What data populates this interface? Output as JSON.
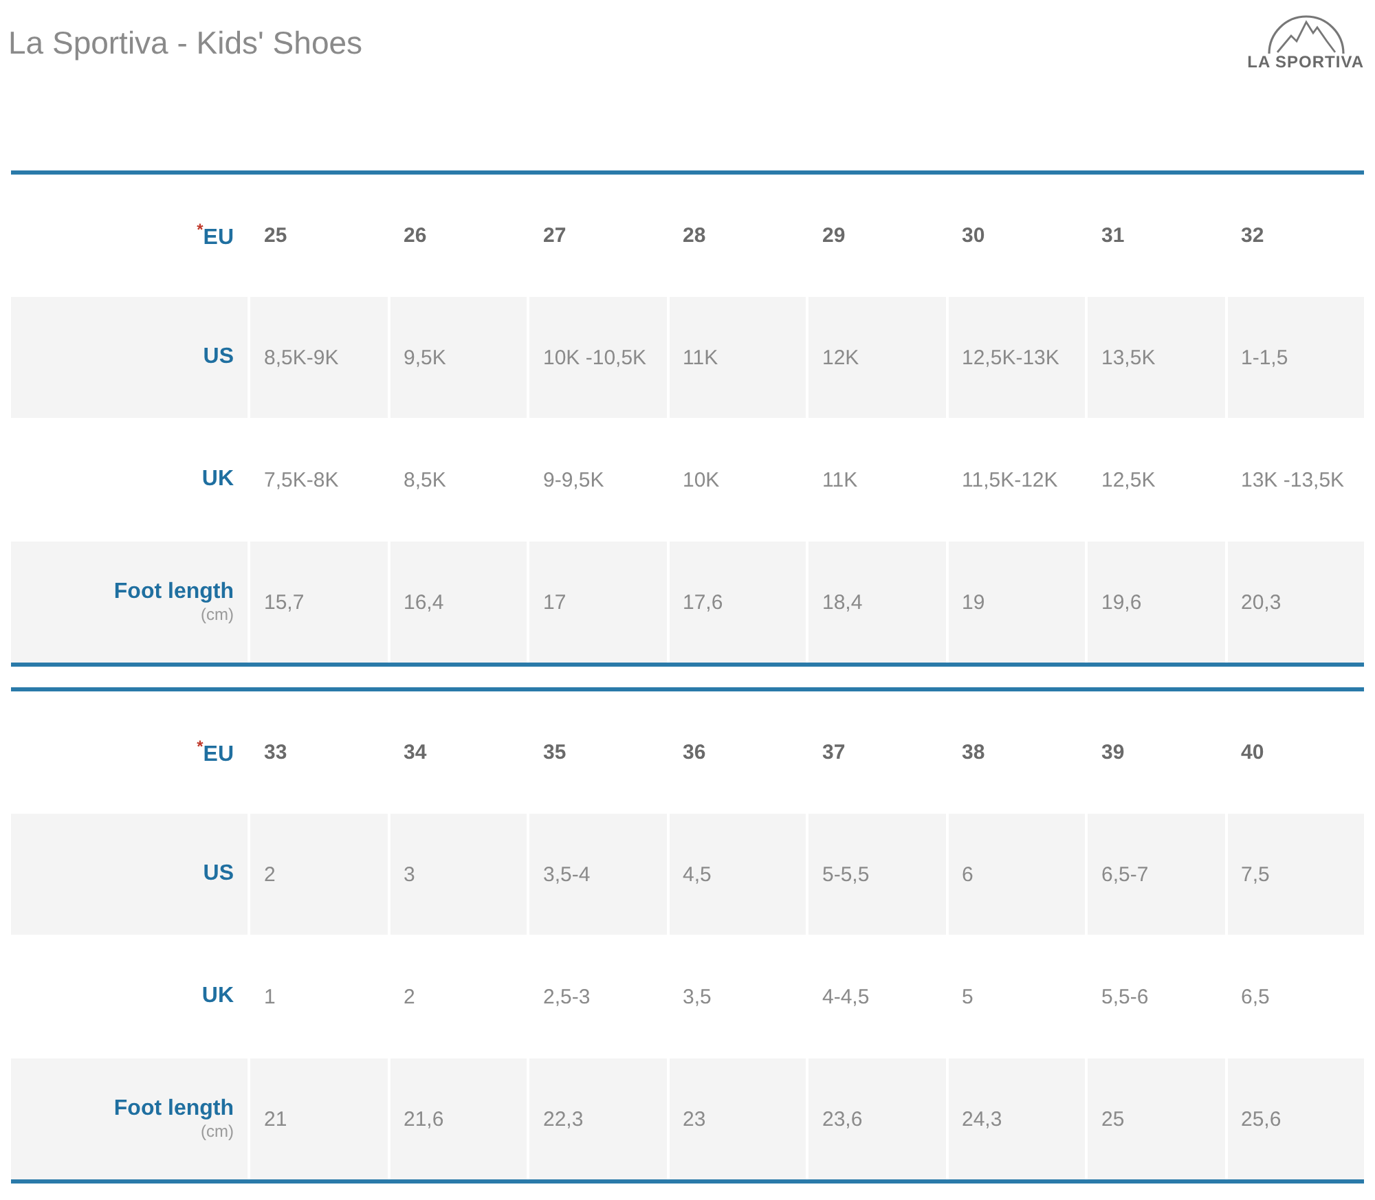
{
  "title": "La Sportiva - Kids' Shoes",
  "logo": {
    "text": "LA SPORTIVA"
  },
  "tables": [
    {
      "rows": [
        {
          "kind": "header",
          "label": "$^{*}$EU",
          "cells": [
            "25",
            "26",
            "27",
            "28",
            "29",
            "30",
            "31",
            "32"
          ]
        },
        {
          "kind": "size",
          "label": "US",
          "cells": [
            "8,5K-9K",
            "9,5K",
            "10K -10,5K",
            "11K",
            "12K",
            "12,5K-13K",
            "13,5K",
            "1-1,5"
          ]
        },
        {
          "kind": "size",
          "label": "UK",
          "cells": [
            "7,5K-8K",
            "8,5K",
            "9-9,5K",
            "10K",
            "11K",
            "11,5K-12K",
            "12,5K",
            "13K -13,5K"
          ]
        },
        {
          "kind": "size",
          "label": "Foot length",
          "unit": "(cm)",
          "cells": [
            "15,7",
            "16,4",
            "17",
            "17,6",
            "18,4",
            "19",
            "19,6",
            "20,3"
          ]
        }
      ]
    },
    {
      "rows": [
        {
          "kind": "header",
          "label": "$^{*}$EU",
          "cells": [
            "33",
            "34",
            "35",
            "36",
            "37",
            "38",
            "39",
            "40"
          ]
        },
        {
          "kind": "size",
          "label": "US",
          "cells": [
            "2",
            "3",
            "3,5-4",
            "4,5",
            "5-5,5",
            "6",
            "6,5-7",
            "7,5"
          ]
        },
        {
          "kind": "size",
          "label": "UK",
          "cells": [
            "1",
            "2",
            "2,5-3",
            "3,5",
            "4-4,5",
            "5",
            "5,5-6",
            "6,5"
          ]
        },
        {
          "kind": "size",
          "label": "Foot length",
          "unit": "(cm)",
          "cells": [
            "21",
            "21,6",
            "22,3",
            "23",
            "23,6",
            "24,3",
            "25",
            "25,6"
          ]
        }
      ]
    }
  ]
}
